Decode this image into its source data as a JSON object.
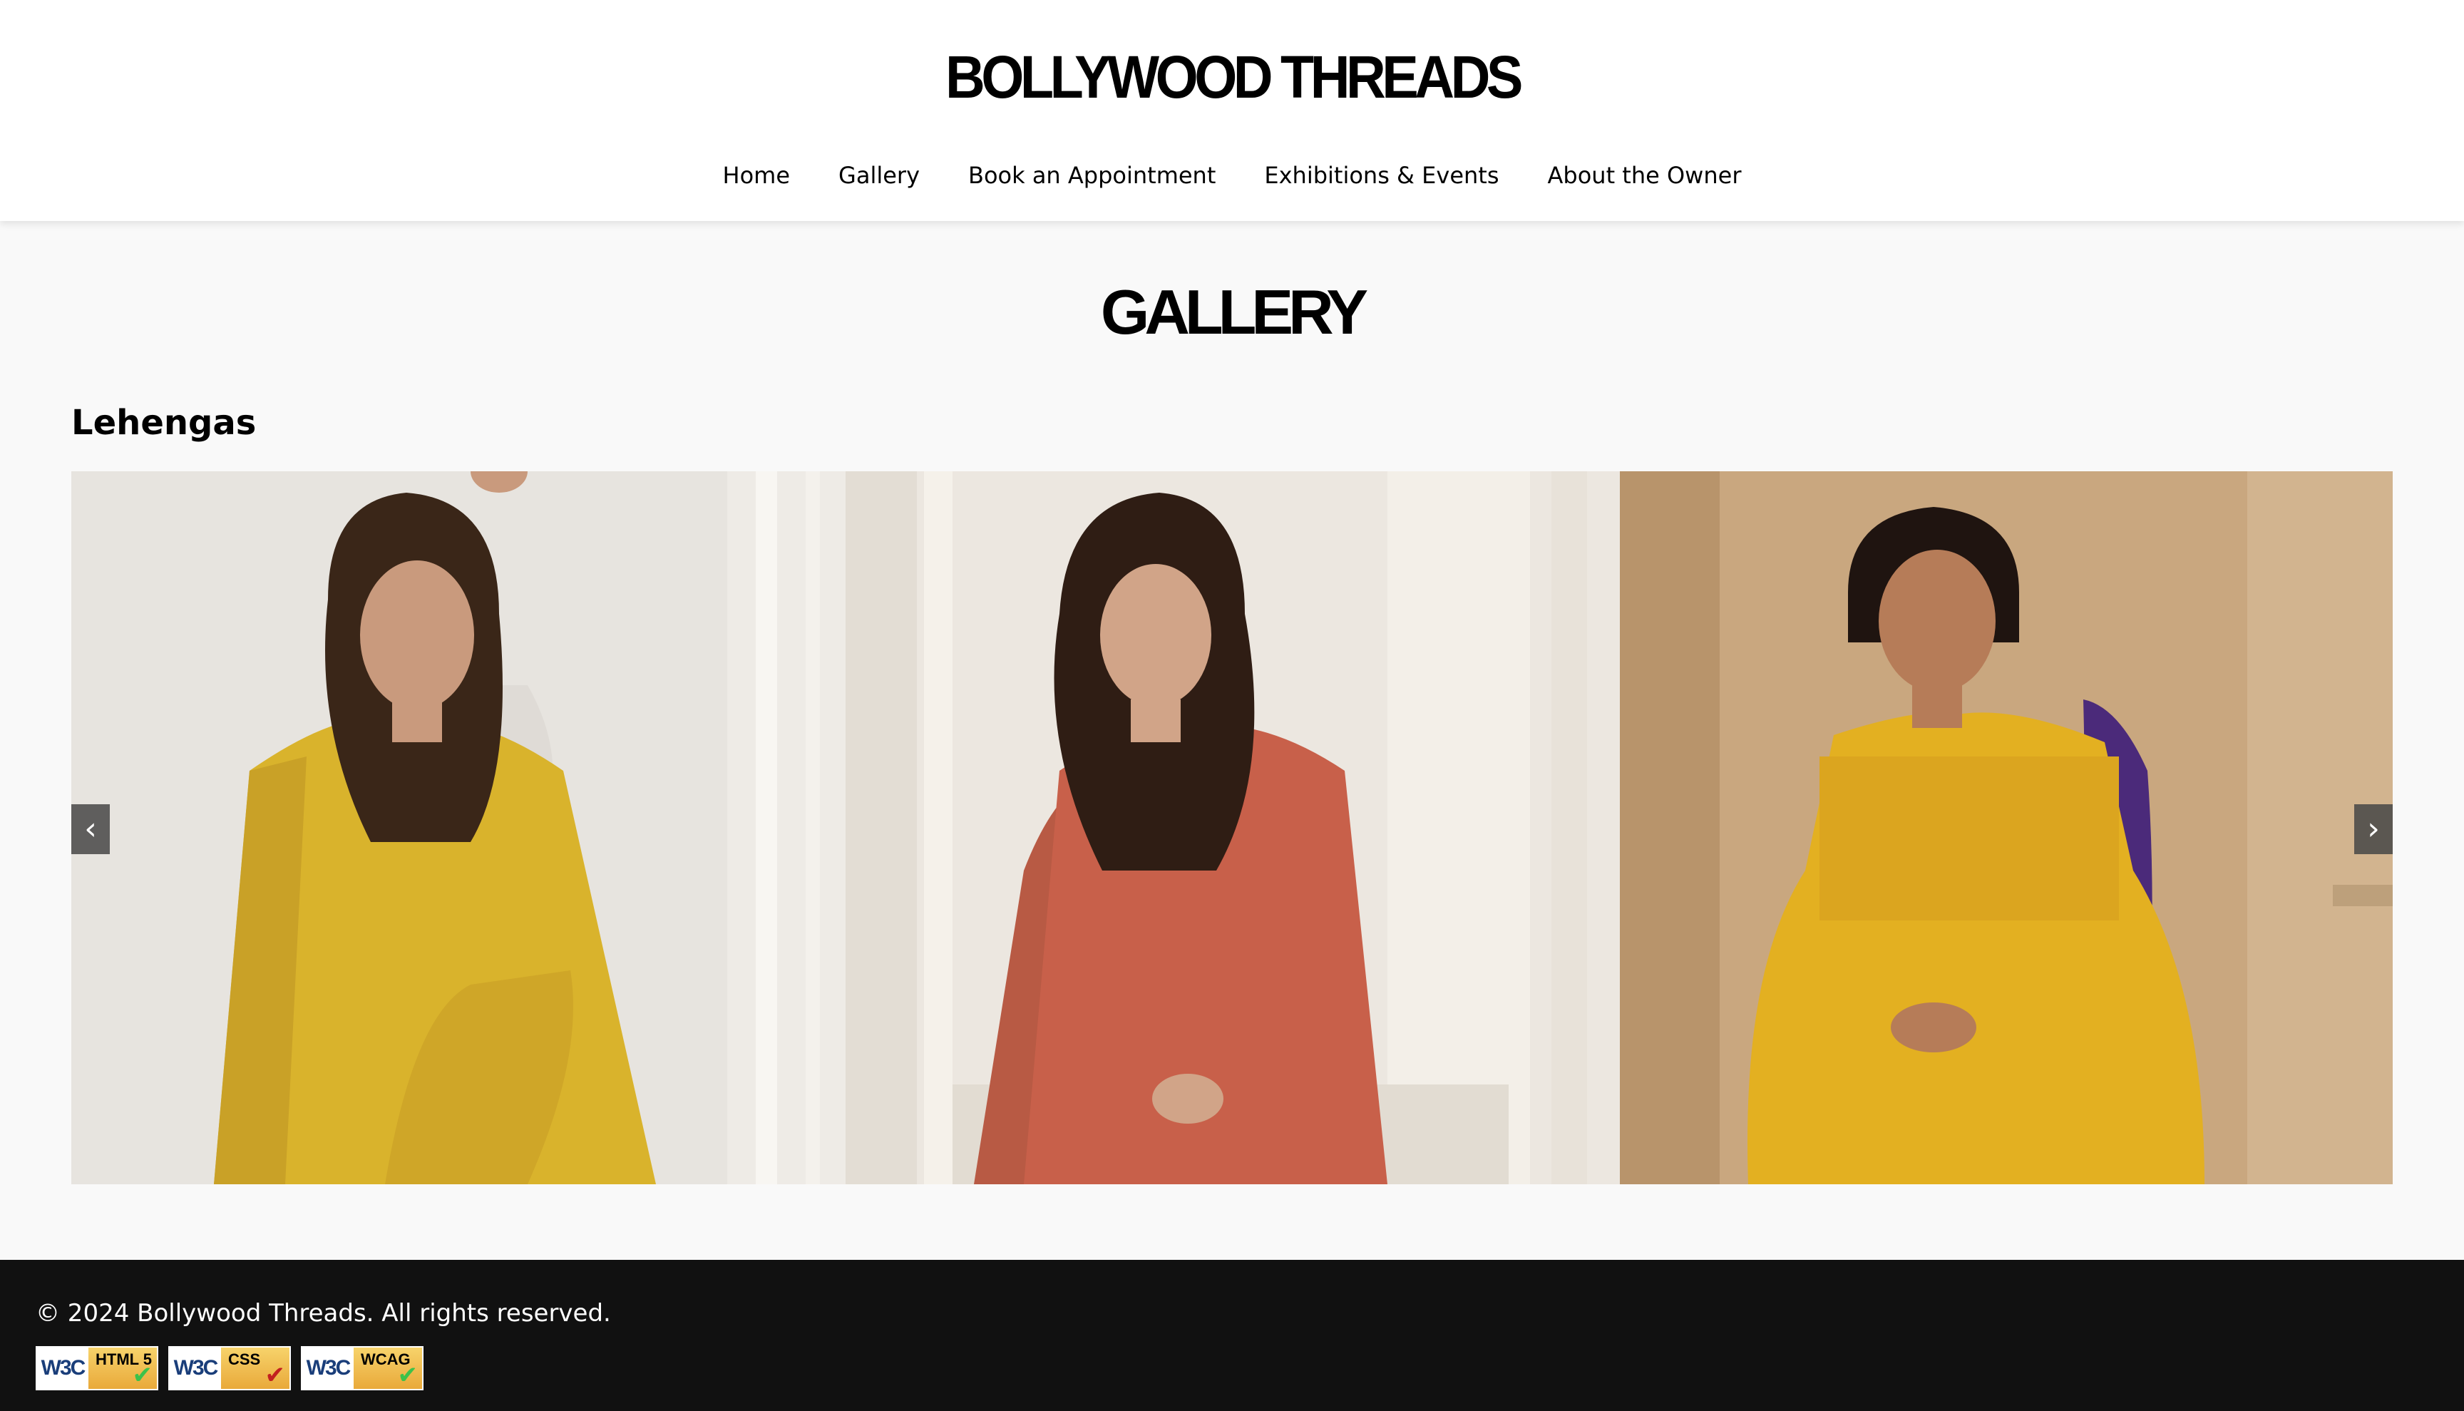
{
  "header": {
    "logo_text": "BOLLYWOOD THREADS",
    "nav": [
      {
        "label": "Home"
      },
      {
        "label": "Gallery"
      },
      {
        "label": "Book an Appointment"
      },
      {
        "label": "Exhibitions & Events"
      },
      {
        "label": "About the Owner"
      }
    ]
  },
  "main": {
    "page_title": "GALLERY",
    "section_heading": "Lehengas",
    "carousel": {
      "prev_label": "‹",
      "next_label": "›",
      "slides": [
        {
          "dress_color": "#d9b32c",
          "backdrop": "#e6e3de"
        },
        {
          "dress_color": "#c8604a",
          "backdrop": "#ebe6df"
        },
        {
          "dress_color": "#e3b021",
          "backdrop": "#c9a77f",
          "dupatta_color": "#4b2a7a"
        }
      ]
    }
  },
  "footer": {
    "copyright": "© 2024 Bollywood Threads. All rights reserved.",
    "badges": [
      {
        "brand": "W3C",
        "label": "HTML 5",
        "check_color": "#3cc24a"
      },
      {
        "brand": "W3C",
        "label": "CSS",
        "check_color": "#c21f1f"
      },
      {
        "brand": "W3C",
        "label": "WCAG",
        "check_color": "#3cc24a"
      }
    ]
  },
  "colors": {
    "header_bg": "#ffffff",
    "main_bg": "#f9f9f9",
    "footer_bg": "#111111"
  }
}
